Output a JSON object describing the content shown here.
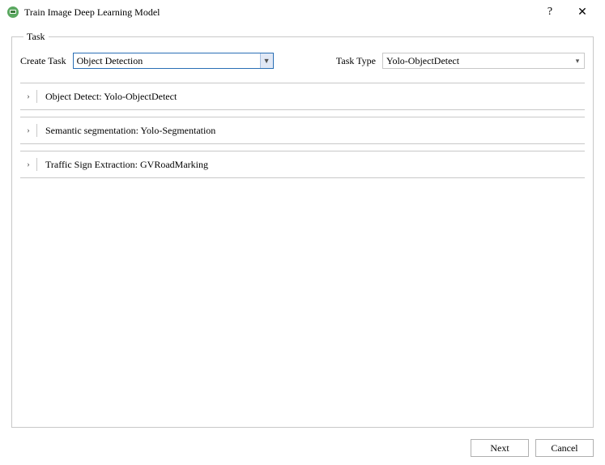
{
  "window": {
    "title": "Train Image Deep Learning Model",
    "help_tooltip": "?",
    "close_tooltip": "✕"
  },
  "task": {
    "legend": "Task",
    "create_label": "Create Task",
    "create_value": "Object Detection",
    "type_label": "Task Type",
    "type_value": "Yolo-ObjectDetect",
    "items": [
      {
        "label": "Object Detect: Yolo-ObjectDetect"
      },
      {
        "label": "Semantic segmentation: Yolo-Segmentation"
      },
      {
        "label": "Traffic Sign Extraction: GVRoadMarking"
      }
    ]
  },
  "footer": {
    "next": "Next",
    "cancel": "Cancel"
  }
}
